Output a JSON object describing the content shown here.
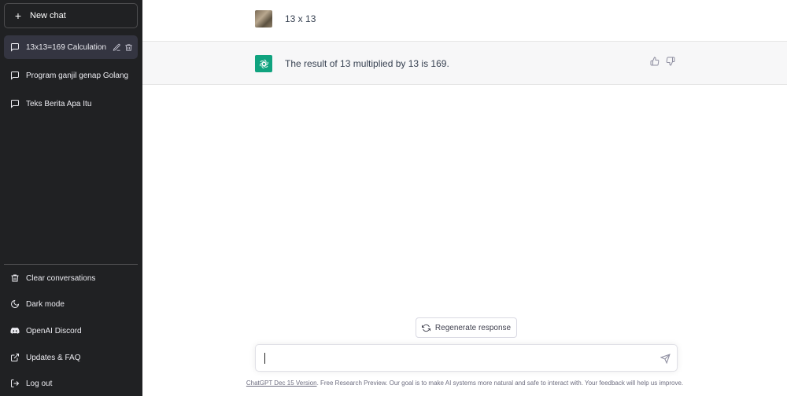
{
  "sidebar": {
    "new_chat_label": "New chat",
    "conversations": [
      {
        "label": "13x13=169 Calculation",
        "active": true
      },
      {
        "label": "Program ganjil genap Golang",
        "active": false
      },
      {
        "label": "Teks Berita Apa Itu",
        "active": false
      }
    ],
    "menu": [
      {
        "label": "Clear conversations",
        "icon": "trash-icon"
      },
      {
        "label": "Dark mode",
        "icon": "moon-icon"
      },
      {
        "label": "OpenAI Discord",
        "icon": "discord-icon"
      },
      {
        "label": "Updates & FAQ",
        "icon": "external-link-icon"
      },
      {
        "label": "Log out",
        "icon": "logout-icon"
      }
    ]
  },
  "chat": {
    "user_message": "13 x 13",
    "assistant_message": "The result of 13 multiplied by 13 is 169."
  },
  "regenerate_label": "Regenerate response",
  "input": {
    "value": "",
    "placeholder": ""
  },
  "footer": {
    "link_text": "ChatGPT Dec 15 Version",
    "text": ". Free Research Preview. Our goal is to make AI systems more natural and safe to interact with. Your feedback will help us improve."
  },
  "colors": {
    "sidebar_bg": "#202123",
    "active_conv_bg": "#343541",
    "assistant_row_bg": "#f7f7f8",
    "assistant_avatar": "#10a37f"
  }
}
